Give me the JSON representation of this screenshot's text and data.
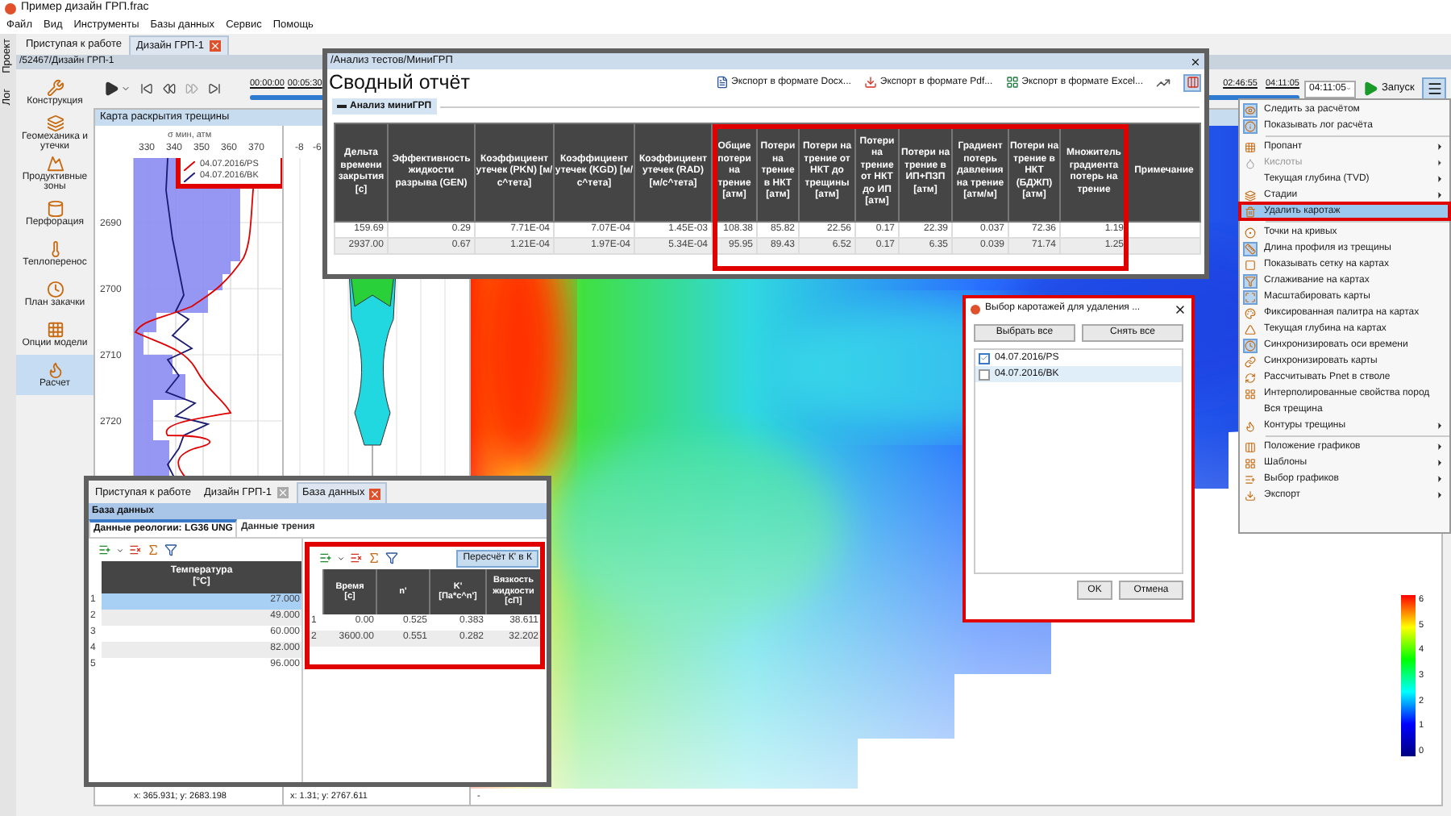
{
  "window": {
    "title": "Пример дизайн ГРП.frac"
  },
  "menu": [
    "Файл",
    "Вид",
    "Инструменты",
    "Базы данных",
    "Сервис",
    "Помощь"
  ],
  "side_strip": [
    "Проект",
    "Лог"
  ],
  "tabs": [
    {
      "label": "Приступая к работе",
      "selected": false
    },
    {
      "label": "Дизайн ГРП-1",
      "selected": true
    }
  ],
  "path": "/52467/Дизайн ГРП-1",
  "sidebar": {
    "items": [
      {
        "label": "Конструкция",
        "selected": false
      },
      {
        "label": "Геомеханика и утечки",
        "selected": false
      },
      {
        "label": "Продуктивные зоны",
        "selected": false
      },
      {
        "label": "Перфорация",
        "selected": false
      },
      {
        "label": "Теплоперенос",
        "selected": false
      },
      {
        "label": "План закачки",
        "selected": false
      },
      {
        "label": "Опции модели",
        "selected": false
      },
      {
        "label": "Расчет",
        "selected": true
      }
    ]
  },
  "toolbar": {
    "start_times": [
      "00:00:00",
      "00:05:30"
    ],
    "end_times": [
      "02:46:55",
      "04:11:05"
    ],
    "level": 1,
    "time_select": "04:11:05",
    "run": "Запуск"
  },
  "panel": {
    "title": "Карта раскрытия трещины",
    "log_chart": {
      "axis_title": "σ мин, атм",
      "xticks": [
        "330",
        "340",
        "350",
        "360",
        "370"
      ],
      "depths": [
        "2690",
        "2700",
        "2710",
        "2720"
      ],
      "legend": [
        {
          "label": "04.07.2016/PS",
          "color": "#e00000"
        },
        {
          "label": "04.07.2016/BK",
          "color": "#1a1a80"
        }
      ],
      "status": "x: 365.931; y: 2683.198"
    },
    "profile_chart": {
      "xticks": [
        "-8",
        "-6"
      ],
      "status": "x: 1.31; y: 2767.611"
    },
    "map": {
      "status": "-",
      "scale_ticks": [
        "6",
        "5",
        "4",
        "3",
        "2",
        "1",
        "0"
      ]
    }
  },
  "report": {
    "path": "/Анализ тестов/МиниГРП",
    "title": "Сводный отчёт",
    "exports": [
      "Экспорт в формате Docx...",
      "Экспорт в формате Pdf...",
      "Экспорт в формате Excel..."
    ],
    "section": "Анализ миниГРП",
    "columns": [
      "Дельта времени закрытия [с]",
      "Эффективность жидкости разрыва (GEN)",
      "Коэффициент утечек (PKN) [м/с^тета]",
      "Коэффициент утечек (KGD) [м/с^тета]",
      "Коэффициент утечек (RAD) [м/с^тета]",
      "Общие потери на трение [атм]",
      "Потери на трение в НКТ [атм]",
      "Потери на трение от НКТ до трещины [атм]",
      "Потери на трение от НКТ до ИП [атм]",
      "Потери на трение в ИП+ПЗП [атм]",
      "Градиент потерь давления на трение [атм/м]",
      "Потери на трение в НКТ (БДЖП) [атм]",
      "Множитель градиента потерь на трение",
      "Примечание"
    ],
    "rows": [
      [
        "159.69",
        "0.29",
        "7.71E-04",
        "7.07E-04",
        "1.45E-03",
        "108.38",
        "85.82",
        "22.56",
        "0.17",
        "22.39",
        "0.037",
        "72.36",
        "1.19"
      ],
      [
        "2937.00",
        "0.67",
        "1.21E-04",
        "1.97E-04",
        "5.34E-04",
        "95.95",
        "89.43",
        "6.52",
        "0.17",
        "6.35",
        "0.039",
        "71.74",
        "1.25"
      ]
    ]
  },
  "context_menu": [
    {
      "kind": "item",
      "label": "Следить за расчётом",
      "checked": true,
      "selected": false,
      "disabled": false,
      "submenu": false
    },
    {
      "kind": "item",
      "label": "Показывать лог расчёта",
      "checked": true,
      "selected": false,
      "disabled": false,
      "submenu": false
    },
    {
      "kind": "separator"
    },
    {
      "kind": "item",
      "label": "Пропант",
      "checked": false,
      "selected": false,
      "disabled": false,
      "submenu": true
    },
    {
      "kind": "item",
      "label": "Кислоты",
      "checked": false,
      "selected": false,
      "disabled": true,
      "submenu": true
    },
    {
      "kind": "item",
      "label": "Текущая глубина (TVD)",
      "checked": false,
      "selected": false,
      "disabled": false,
      "submenu": true
    },
    {
      "kind": "item",
      "label": "Стадии",
      "checked": false,
      "selected": false,
      "disabled": false,
      "submenu": true
    },
    {
      "kind": "item",
      "label": "Удалить каротаж",
      "checked": false,
      "selected": true,
      "disabled": false,
      "submenu": false
    },
    {
      "kind": "separator"
    },
    {
      "kind": "item",
      "label": "Точки на кривых",
      "checked": false,
      "selected": false,
      "disabled": false,
      "submenu": false
    },
    {
      "kind": "item",
      "label": "Длина профиля из трещины",
      "checked": true,
      "selected": false,
      "disabled": false,
      "submenu": false
    },
    {
      "kind": "item",
      "label": "Показывать сетку на картах",
      "checked": false,
      "selected": false,
      "disabled": false,
      "submenu": false
    },
    {
      "kind": "item",
      "label": "Сглаживание на картах",
      "checked": true,
      "selected": false,
      "disabled": false,
      "submenu": false
    },
    {
      "kind": "item",
      "label": "Масштабировать карты",
      "checked": true,
      "selected": false,
      "disabled": false,
      "submenu": false
    },
    {
      "kind": "item",
      "label": "Фиксированная палитра на картах",
      "checked": false,
      "selected": false,
      "disabled": false,
      "submenu": false
    },
    {
      "kind": "item",
      "label": "Текущая глубина на картах",
      "checked": false,
      "selected": false,
      "disabled": false,
      "submenu": false
    },
    {
      "kind": "item",
      "label": "Синхронизировать оси времени",
      "checked": true,
      "selected": false,
      "disabled": false,
      "submenu": false
    },
    {
      "kind": "item",
      "label": "Синхронизировать карты",
      "checked": false,
      "selected": false,
      "disabled": false,
      "submenu": false
    },
    {
      "kind": "item",
      "label": "Рассчитывать Pnet в стволе",
      "checked": false,
      "selected": false,
      "disabled": false,
      "submenu": false
    },
    {
      "kind": "item",
      "label": "Интерполированные свойства пород",
      "checked": false,
      "selected": false,
      "disabled": false,
      "submenu": false
    },
    {
      "kind": "item",
      "label": "Вся трещина",
      "checked": false,
      "selected": false,
      "disabled": false,
      "submenu": false
    },
    {
      "kind": "item",
      "label": "Контуры трещины",
      "checked": false,
      "selected": false,
      "disabled": false,
      "submenu": true
    },
    {
      "kind": "separator"
    },
    {
      "kind": "item",
      "label": "Положение графиков",
      "checked": false,
      "selected": false,
      "disabled": false,
      "submenu": true
    },
    {
      "kind": "item",
      "label": "Шаблоны",
      "checked": false,
      "selected": false,
      "disabled": false,
      "submenu": true
    },
    {
      "kind": "item",
      "label": "Выбор графиков",
      "checked": false,
      "selected": false,
      "disabled": false,
      "submenu": true
    },
    {
      "kind": "item",
      "label": "Экспорт",
      "checked": false,
      "selected": false,
      "disabled": false,
      "submenu": true
    }
  ],
  "dialog": {
    "title": "Выбор каротажей для удаления ...",
    "top_buttons": [
      "Выбрать все",
      "Снять все"
    ],
    "items": [
      {
        "label": "04.07.2016/PS",
        "checked": true,
        "selected": false
      },
      {
        "label": "04.07.2016/BK",
        "checked": false,
        "selected": true
      }
    ],
    "buttons": [
      "OK",
      "Отмена"
    ]
  },
  "database_window": {
    "tabs": [
      {
        "label": "Приступая к работе",
        "selected": false,
        "closable": false
      },
      {
        "label": "Дизайн ГРП-1",
        "selected": false,
        "closable": true
      },
      {
        "label": "База данных",
        "selected": true,
        "closable": true
      }
    ],
    "header": "База данных",
    "subtabs": [
      {
        "label": "Данные реологии: LG36 UNG",
        "selected": true
      },
      {
        "label": "Данные трения",
        "selected": false
      }
    ],
    "temperature_table": {
      "column": "Температура\n[°C]",
      "rows": [
        {
          "n": "1",
          "value": "27.000",
          "selected": true
        },
        {
          "n": "2",
          "value": "49.000",
          "selected": false
        },
        {
          "n": "3",
          "value": "60.000",
          "selected": false
        },
        {
          "n": "4",
          "value": "82.000",
          "selected": false
        },
        {
          "n": "5",
          "value": "96.000",
          "selected": false
        }
      ]
    },
    "rheology": {
      "recalc": "Пересчёт К' в К",
      "columns": [
        "Время\n[с]",
        "n'",
        "K'\n[Па*с^n']",
        "Вязкость жидкости\n[сП]"
      ],
      "rows": [
        {
          "n": "1",
          "cells": [
            "0.00",
            "0.525",
            "0.383",
            "38.611"
          ]
        },
        {
          "n": "2",
          "cells": [
            "3600.00",
            "0.551",
            "0.282",
            "32.202"
          ]
        }
      ]
    }
  }
}
